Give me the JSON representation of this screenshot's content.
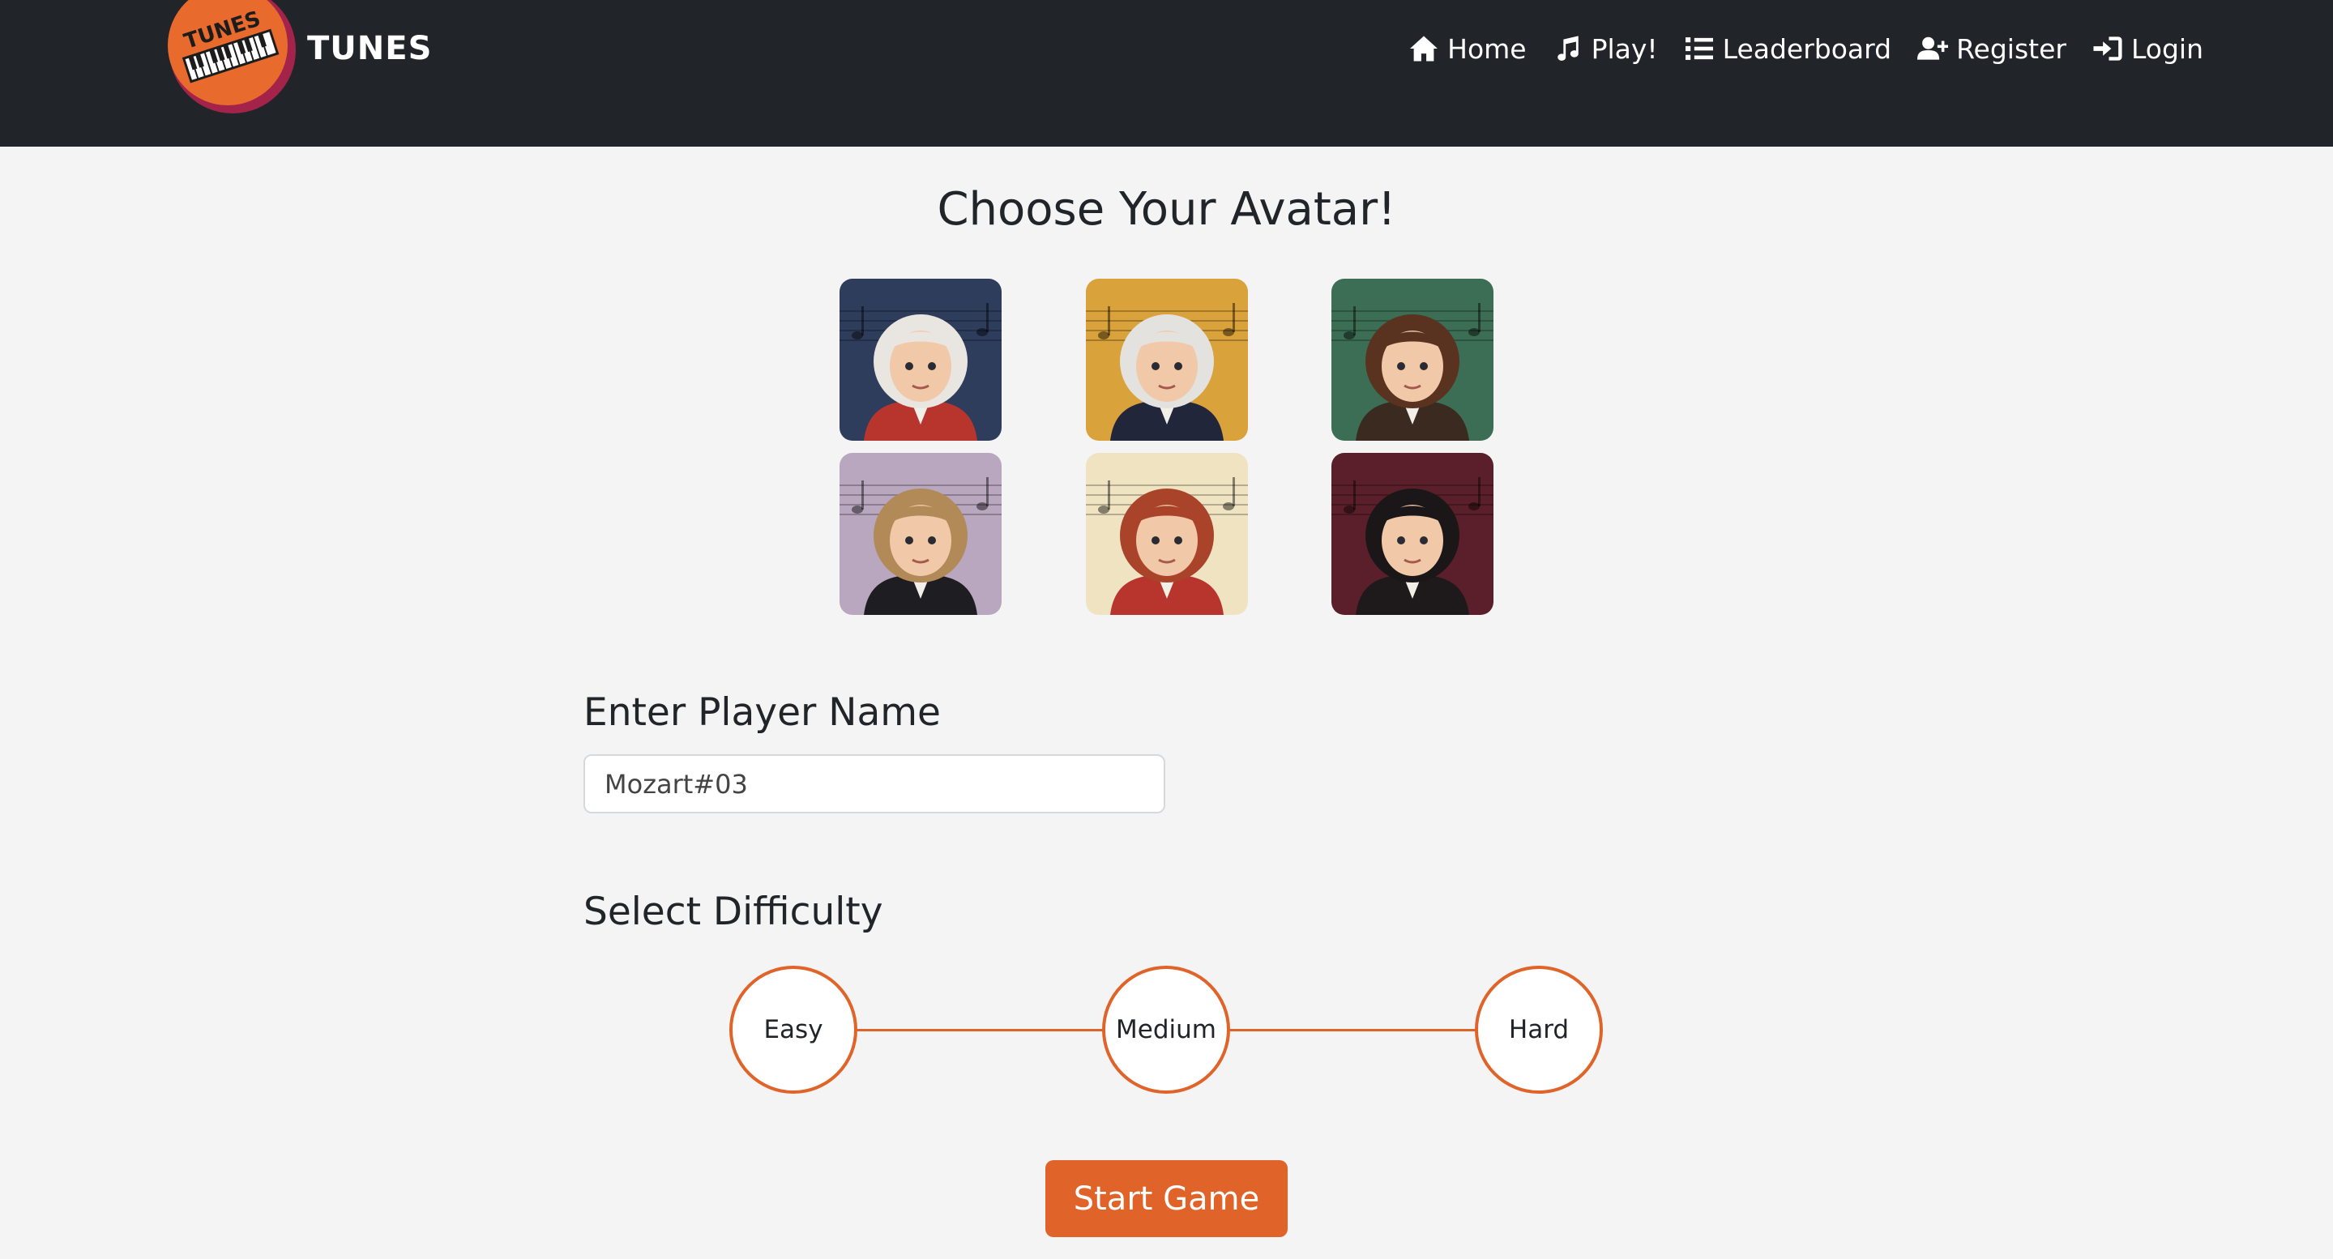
{
  "app": {
    "brand_name": "TUNES",
    "logo_text": "TUNES",
    "colors": {
      "navbar_bg": "#212529",
      "page_bg": "#f4f4f4",
      "accent": "#e0642a",
      "text": "#212529"
    }
  },
  "nav": {
    "items": [
      {
        "label": "Home",
        "icon": "home-icon"
      },
      {
        "label": "Play!",
        "icon": "music-note-icon"
      },
      {
        "label": "Leaderboard",
        "icon": "list-icon"
      },
      {
        "label": "Register",
        "icon": "user-plus-icon"
      },
      {
        "label": "Login",
        "icon": "sign-in-icon"
      }
    ]
  },
  "main": {
    "title": "Choose Your Avatar!",
    "avatars": [
      {
        "bg": "#2f3d5c",
        "hair": "#e9e6e2",
        "coat": "#b8352e"
      },
      {
        "bg": "#d9a23a",
        "hair": "#e4e2de",
        "coat": "#22263a"
      },
      {
        "bg": "#3c6e55",
        "hair": "#5a3320",
        "coat": "#3a2a20"
      },
      {
        "bg": "#b8a7bf",
        "hair": "#b28a58",
        "coat": "#1e1e22"
      },
      {
        "bg": "#efe3c2",
        "hair": "#a9432a",
        "coat": "#b8352e"
      },
      {
        "bg": "#5b1f2b",
        "hair": "#1b1718",
        "coat": "#1e1a1c"
      }
    ],
    "player_name": {
      "label": "Enter Player Name",
      "value": "Mozart#03"
    },
    "difficulty": {
      "label": "Select Difficulty",
      "options": [
        "Easy",
        "Medium",
        "Hard"
      ]
    },
    "start_button": "Start Game"
  }
}
